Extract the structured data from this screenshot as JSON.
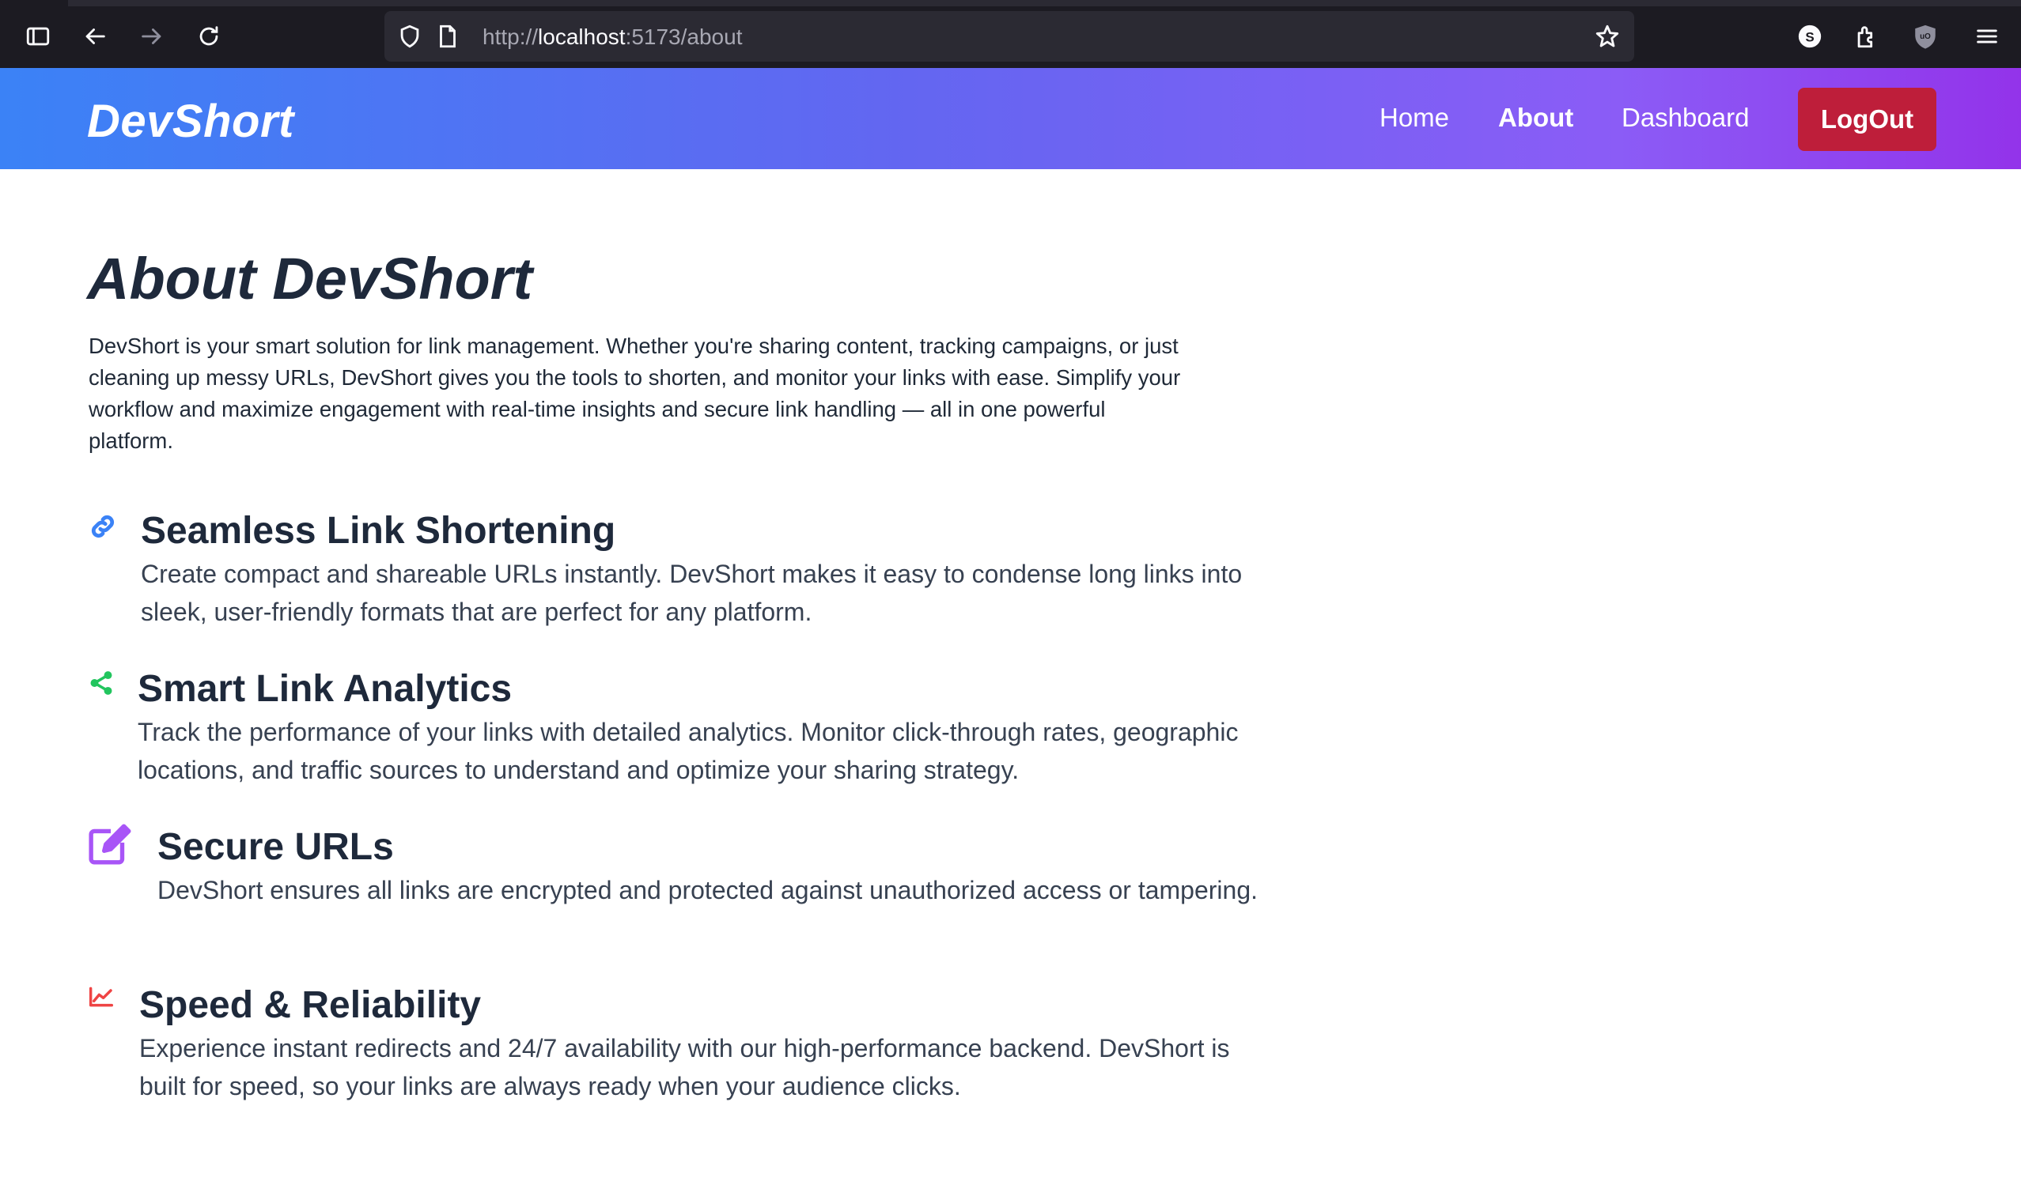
{
  "browser": {
    "url_scheme": "http://",
    "url_host": "localhost",
    "url_path": ":5173/about",
    "icons": [
      "sidebar-icon",
      "back-icon",
      "forward-icon",
      "reload-icon",
      "shield-icon",
      "page-icon",
      "bookmark-star-icon",
      "account-icon",
      "extensions-icon",
      "ublock-icon",
      "menu-icon"
    ],
    "account_letter": "S"
  },
  "navbar": {
    "brand": "DevShort",
    "links": [
      {
        "label": "Home",
        "active": false
      },
      {
        "label": "About",
        "active": true
      },
      {
        "label": "Dashboard",
        "active": false
      }
    ],
    "logout_label": "LogOut",
    "logout_color": "#be1e3a"
  },
  "page": {
    "title": "About DevShort",
    "intro": "DevShort is your smart solution for link management. Whether you're sharing content, tracking campaigns, or just cleaning up messy URLs, DevShort gives you the tools to shorten, and monitor your links with ease. Simplify your workflow and maximize engagement with real-time insights and secure link handling — all in one powerful platform."
  },
  "features": [
    {
      "title": "Seamless Link Shortening",
      "text": "Create compact and shareable URLs instantly. DevShort makes it easy to condense long links into sleek, user-friendly formats that are perfect for any platform.",
      "icon": "link-icon",
      "color": "#3b82f6"
    },
    {
      "title": "Smart Link Analytics",
      "text": "Track the performance of your links with detailed analytics. Monitor click-through rates, geographic locations, and traffic sources to understand and optimize your sharing strategy.",
      "icon": "share-icon",
      "color": "#22c55e"
    },
    {
      "title": "Secure URLs",
      "text": "DevShort ensures all links are encrypted and protected against unauthorized access or tampering.",
      "icon": "edit-icon",
      "color": "#a855f7"
    },
    {
      "title": "Speed & Reliability",
      "text": "Experience instant redirects and 24/7 availability with our high-performance backend. DevShort is built for speed, so your links are always ready when your audience clicks.",
      "icon": "trend-chart-icon",
      "color": "#ef4444"
    }
  ]
}
